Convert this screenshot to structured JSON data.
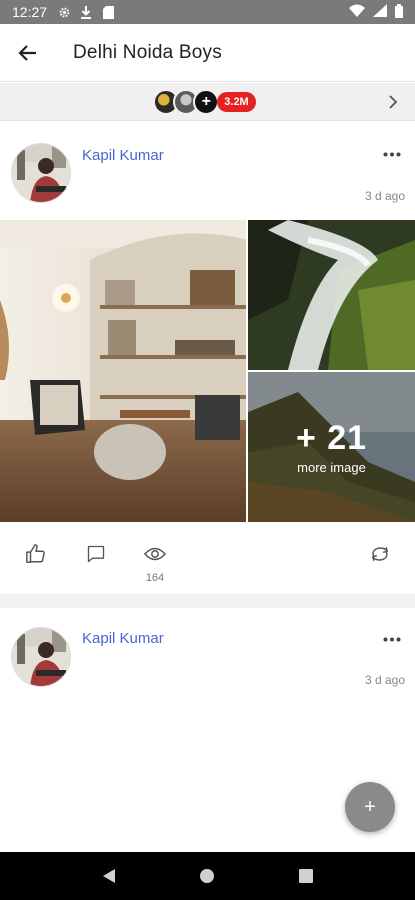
{
  "status_bar": {
    "time": "12:27",
    "left_icons": [
      "gear-icon",
      "download-icon",
      "sd-card-icon"
    ],
    "right_icons": [
      "wifi-icon",
      "signal-icon",
      "battery-icon"
    ]
  },
  "app_bar": {
    "title": "Delhi Noida Boys",
    "back_icon": "arrow-left-icon"
  },
  "members": {
    "plus_symbol": "+",
    "count": "3.2M",
    "badge_color": "#e52222"
  },
  "posts": [
    {
      "author": "Kapil Kumar",
      "time_ago": "3 d ago",
      "gallery": {
        "extra_count": "+ 21",
        "extra_label": "more image"
      },
      "views": "164"
    },
    {
      "author": "Kapil Kumar",
      "time_ago": "3 d ago"
    }
  ],
  "fab": {
    "symbol": "+",
    "color": "#8a8a8a"
  },
  "colors": {
    "author_link": "#4a64d8",
    "status_bar": "#7a7a7a"
  }
}
